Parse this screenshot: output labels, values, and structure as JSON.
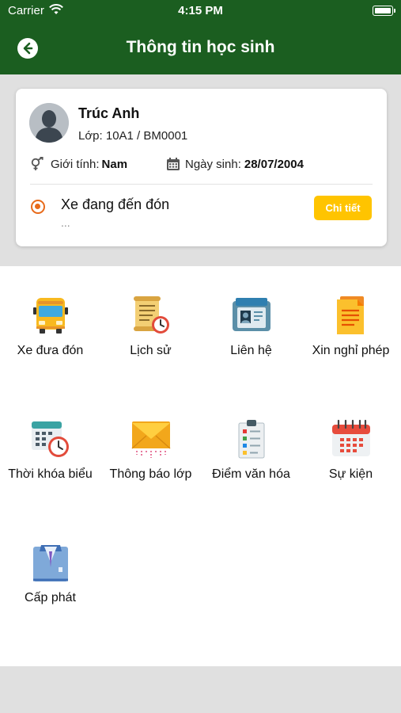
{
  "status_bar": {
    "carrier": "Carrier",
    "time": "4:15 PM"
  },
  "header": {
    "title": "Thông tin học sinh"
  },
  "student": {
    "name": "Trúc Anh",
    "class_line": "Lớp: 10A1 / BM0001",
    "gender_label": "Giới tính:",
    "gender_value": "Nam",
    "dob_label": "Ngày sinh:",
    "dob_value": "28/07/2004",
    "pickup_status": "Xe đang đến đón",
    "pickup_sub": "...",
    "detail_button": "Chi tiết"
  },
  "menu": {
    "items": [
      {
        "label": "Xe đưa đón",
        "icon": "school-bus-icon"
      },
      {
        "label": "Lịch sử",
        "icon": "history-scroll-clock-icon"
      },
      {
        "label": "Liên hệ",
        "icon": "contact-card-icon"
      },
      {
        "label": "Xin nghỉ phép",
        "icon": "leave-request-document-icon"
      },
      {
        "label": "Thời khóa biểu",
        "icon": "timetable-calendar-clock-icon"
      },
      {
        "label": "Thông báo lớp",
        "icon": "class-notice-envelope-icon"
      },
      {
        "label": "Điểm văn hóa",
        "icon": "grades-clipboard-icon"
      },
      {
        "label": "Sự kiện",
        "icon": "event-calendar-icon"
      },
      {
        "label": "Cấp phát",
        "icon": "uniform-issue-shirt-icon"
      }
    ]
  },
  "colors": {
    "header_green": "#1b5e20",
    "accent_orange": "#e86a1a",
    "button_yellow": "#ffc400"
  }
}
